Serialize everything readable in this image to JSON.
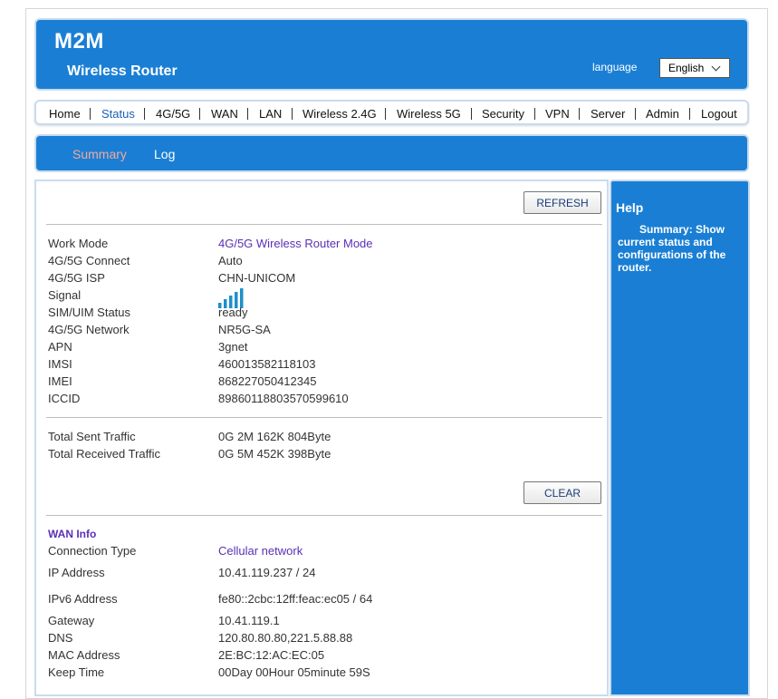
{
  "header": {
    "brand": "M2M",
    "subtitle": "Wireless Router",
    "language_label": "language",
    "language_selected": "English"
  },
  "nav": {
    "items": [
      {
        "label": "Home",
        "active": false
      },
      {
        "label": "Status",
        "active": true
      },
      {
        "label": "4G/5G",
        "active": false
      },
      {
        "label": "WAN",
        "active": false
      },
      {
        "label": "LAN",
        "active": false
      },
      {
        "label": "Wireless 2.4G",
        "active": false
      },
      {
        "label": "Wireless 5G",
        "active": false
      },
      {
        "label": "Security",
        "active": false
      },
      {
        "label": "VPN",
        "active": false
      },
      {
        "label": "Server",
        "active": false
      },
      {
        "label": "Admin",
        "active": false
      },
      {
        "label": "Logout",
        "active": false
      }
    ]
  },
  "subnav": {
    "items": [
      {
        "label": "Summary",
        "active": true
      },
      {
        "label": "Log",
        "active": false
      }
    ]
  },
  "buttons": {
    "refresh": "REFRESH",
    "clear": "CLEAR"
  },
  "status": {
    "rows": [
      {
        "label": "Work Mode",
        "value": "4G/5G Wireless Router Mode"
      },
      {
        "label": "4G/5G Connect",
        "value": "Auto"
      },
      {
        "label": "4G/5G ISP",
        "value": "CHN-UNICOM"
      },
      {
        "label": "Signal",
        "value": ""
      },
      {
        "label": "SIM/UIM Status",
        "value": "ready"
      },
      {
        "label": "4G/5G Network",
        "value": "NR5G-SA"
      },
      {
        "label": "APN",
        "value": "3gnet"
      },
      {
        "label": "IMSI",
        "value": "460013582118103"
      },
      {
        "label": "IMEI",
        "value": "868227050412345"
      },
      {
        "label": "ICCID",
        "value": "89860118803570599610"
      }
    ],
    "signal_bars": 5
  },
  "traffic": {
    "rows": [
      {
        "label": "Total Sent Traffic",
        "value": "0G 2M 162K 804Byte"
      },
      {
        "label": "Total Received Traffic",
        "value": "0G 5M 452K 398Byte"
      }
    ]
  },
  "wan": {
    "title": "WAN Info",
    "rows": [
      {
        "label": "Connection Type",
        "value": "Cellular network"
      },
      {
        "label": "IP Address",
        "value": "10.41.119.237 / 24"
      },
      {
        "label": "IPv6 Address",
        "value": "fe80::2cbc:12ff:feac:ec05 / 64"
      },
      {
        "label": "Gateway",
        "value": "10.41.119.1"
      },
      {
        "label": "DNS",
        "value": "120.80.80.80,221.5.88.88"
      },
      {
        "label": "MAC Address",
        "value": "2E:BC:12:AC:EC:05"
      },
      {
        "label": "Keep Time",
        "value": "00Day 00Hour 05minute 59S"
      }
    ]
  },
  "help": {
    "title": "Help",
    "text": "Summary: Show current status and configurations of the router."
  },
  "colors": {
    "primary": "#1a7fd4",
    "link": "#5a2fb6",
    "signal": "#1f8fc8"
  }
}
